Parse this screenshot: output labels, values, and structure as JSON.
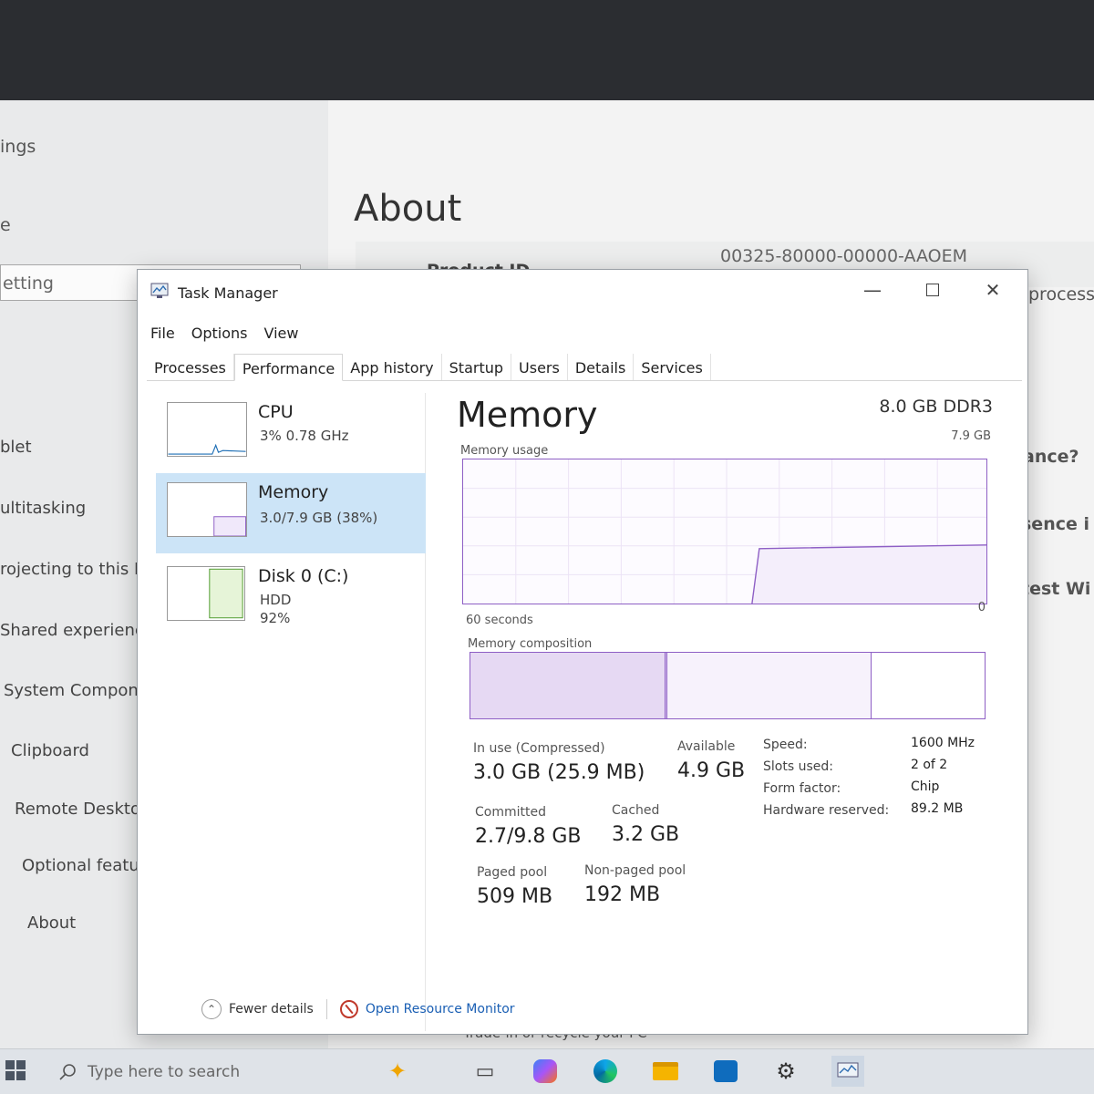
{
  "settings": {
    "header_fragment": "ings",
    "home_fragment": "e",
    "search_placeholder": "etting",
    "nav": [
      {
        "label": "blet"
      },
      {
        "label": "ultitasking"
      },
      {
        "label": "rojecting to this PC"
      },
      {
        "label": "Shared experiences"
      },
      {
        "label": "System Components"
      },
      {
        "label": "Clipboard"
      },
      {
        "label": "Remote Desktop"
      },
      {
        "label": "Optional features"
      },
      {
        "label": "About"
      }
    ],
    "about_title": "About",
    "product_id_label": "Product ID",
    "product_id_value": "00325-80000-00000-AAOEM",
    "right_peeks": [
      "process",
      "ance?",
      "sence i",
      "test Wi"
    ],
    "bottom_text": "Trade-in or recycle your PC"
  },
  "task_manager": {
    "title": "Task Manager",
    "menu": [
      "File",
      "Options",
      "View"
    ],
    "tabs": [
      "Processes",
      "Performance",
      "App history",
      "Startup",
      "Users",
      "Details",
      "Services"
    ],
    "active_tab": "Performance",
    "perf_list": [
      {
        "name": "CPU",
        "sub1": "3%  0.78 GHz",
        "sub2": "",
        "sub3": ""
      },
      {
        "name": "Memory",
        "sub1": "3.0/7.9 GB (38%)",
        "sub2": "",
        "sub3": ""
      },
      {
        "name": "Disk 0 (C:)",
        "sub1": "HDD",
        "sub2": "92%",
        "sub3": ""
      }
    ],
    "memory": {
      "title": "Memory",
      "type": "8.0 GB DDR3",
      "usage_label": "Memory usage",
      "usage_max": "7.9 GB",
      "seconds_label": "60 seconds",
      "zero_label": "0",
      "composition_label": "Memory composition",
      "composition_fractions": [
        0.38,
        0.0,
        0.4,
        0.22
      ],
      "stats": [
        {
          "label": "In use (Compressed)",
          "value": "3.0 GB (25.9 MB)"
        },
        {
          "label": "Available",
          "value": "4.9 GB"
        },
        {
          "label": "Committed",
          "value": "2.7/9.8 GB"
        },
        {
          "label": "Cached",
          "value": "3.2 GB"
        },
        {
          "label": "Paged pool",
          "value": "509 MB"
        },
        {
          "label": "Non-paged pool",
          "value": "192 MB"
        }
      ],
      "details": [
        {
          "label": "Speed:",
          "value": "1600 MHz"
        },
        {
          "label": "Slots used:",
          "value": "2 of 2"
        },
        {
          "label": "Form factor:",
          "value": "Chip"
        },
        {
          "label": "Hardware reserved:",
          "value": "89.2 MB"
        }
      ]
    },
    "footer": {
      "fewer_details": "Fewer details",
      "open_resource_monitor": "Open Resource Monitor"
    }
  },
  "taskbar": {
    "search_placeholder": "Type here to search"
  },
  "colors": {
    "memory_accent": "#8e5fc5",
    "selection": "#cce4f7",
    "link": "#1a5fb4"
  }
}
